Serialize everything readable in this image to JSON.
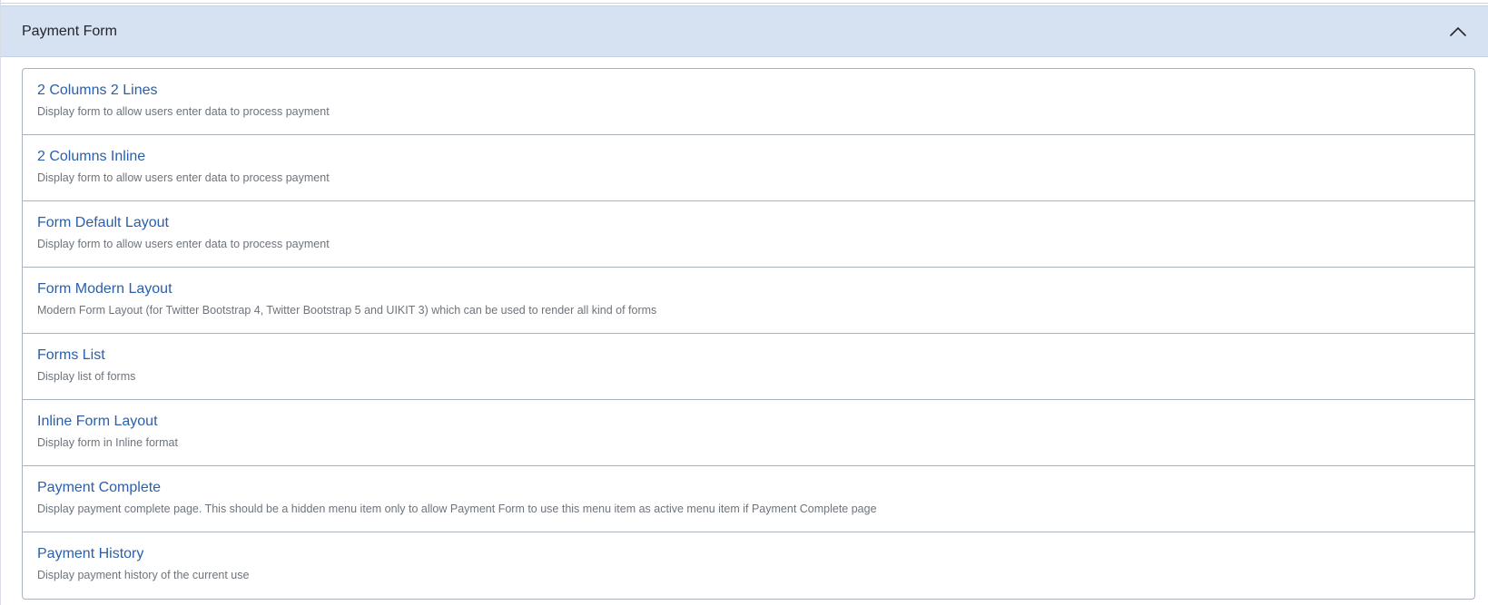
{
  "accordion": {
    "title": "Payment Form",
    "expanded": true,
    "toggle_icon": "chevron-up-icon"
  },
  "items": [
    {
      "title": "2 Columns 2 Lines",
      "description": "Display form to allow users enter data to process payment"
    },
    {
      "title": "2 Columns Inline",
      "description": "Display form to allow users enter data to process payment"
    },
    {
      "title": "Form Default Layout",
      "description": "Display form to allow users enter data to process payment"
    },
    {
      "title": "Form Modern Layout",
      "description": "Modern Form Layout (for Twitter Bootstrap 4, Twitter Bootstrap 5 and UIKIT 3) which can be used to render all kind of forms"
    },
    {
      "title": "Forms List",
      "description": "Display list of forms"
    },
    {
      "title": "Inline Form Layout",
      "description": "Display form in Inline format"
    },
    {
      "title": "Payment Complete",
      "description": "Display payment complete page. This should be a hidden menu item only to allow Payment Form to use this menu item as active menu item if Payment Complete page"
    },
    {
      "title": "Payment History",
      "description": "Display payment history of the current use"
    }
  ],
  "colors": {
    "header_bg": "#d6e2f1",
    "link": "#2a5fac",
    "description": "#6d747c",
    "border": "#aab3bf"
  }
}
